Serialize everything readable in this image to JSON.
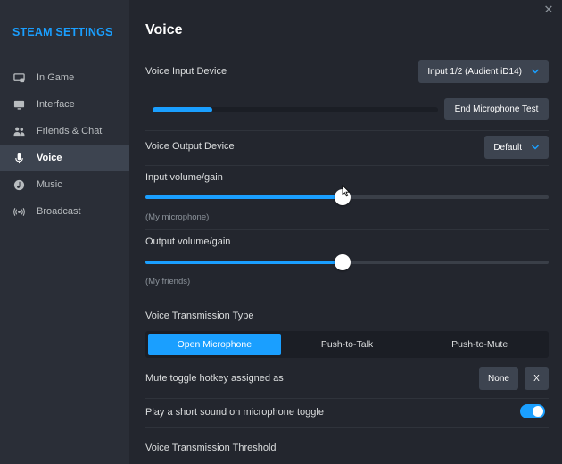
{
  "sidebar": {
    "title": "STEAM SETTINGS",
    "items": [
      {
        "label": "In Game",
        "icon": "in-game-icon"
      },
      {
        "label": "Interface",
        "icon": "monitor-icon"
      },
      {
        "label": "Friends & Chat",
        "icon": "friends-icon"
      },
      {
        "label": "Voice",
        "icon": "microphone-icon"
      },
      {
        "label": "Music",
        "icon": "music-icon"
      },
      {
        "label": "Broadcast",
        "icon": "broadcast-icon"
      }
    ],
    "active": "Voice"
  },
  "main": {
    "title": "Voice",
    "close_icon": "close-icon",
    "input_device": {
      "label": "Voice Input Device",
      "value": "Input 1/2 (Audient iD14)"
    },
    "mic_test": {
      "button": "End Microphone Test",
      "level": 0.21
    },
    "output_device": {
      "label": "Voice Output Device",
      "value": "Default"
    },
    "input_volume": {
      "label": "Input volume/gain",
      "sub": "(My microphone)",
      "value": 0.49
    },
    "output_volume": {
      "label": "Output volume/gain",
      "sub": "(My friends)",
      "value": 0.49
    },
    "transmission": {
      "label": "Voice Transmission Type",
      "options": [
        "Open Microphone",
        "Push-to-Talk",
        "Push-to-Mute"
      ],
      "selected": "Open Microphone"
    },
    "mute_hotkey": {
      "label": "Mute toggle hotkey assigned as",
      "value": "None",
      "clear": "X"
    },
    "toggle_sound": {
      "label": "Play a short sound on microphone toggle",
      "enabled": true
    },
    "threshold": {
      "label": "Voice Transmission Threshold"
    }
  },
  "colors": {
    "accent": "#1a9fff",
    "sidebar_bg": "#2a2e37",
    "main_bg": "#23262e",
    "active_item": "#3d4450"
  }
}
